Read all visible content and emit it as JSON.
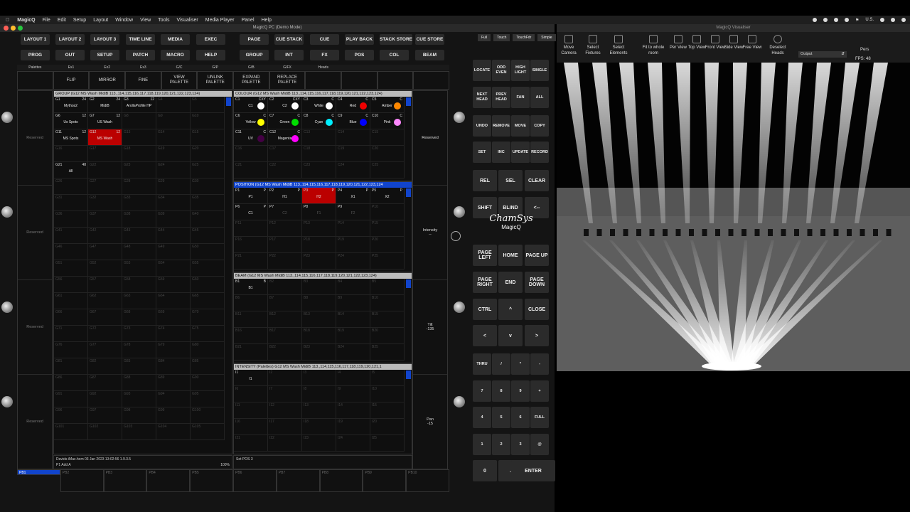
{
  "menubar": {
    "app": "MagicQ",
    "items": [
      "File",
      "Edit",
      "Setup",
      "Layout",
      "Window",
      "View",
      "Tools",
      "Visualiser",
      "Media Player",
      "Panel",
      "Help"
    ],
    "locale": "U.S."
  },
  "window": {
    "title": "MagicQ PC (Demo Mode)"
  },
  "topbuttons": {
    "row1": [
      "LAYOUT 1",
      "LAYOUT 2",
      "LAYOUT 3",
      "TIME LINE",
      "MEDIA",
      "EXEC",
      "PAGE",
      "CUE STACK",
      "CUE",
      "PLAY BACK",
      "STACK STORE",
      "CUE STORE"
    ],
    "row2": [
      "PROG",
      "OUT",
      "SETUP",
      "PATCH",
      "MACRO",
      "HELP",
      "GROUP",
      "INT",
      "FX",
      "POS",
      "COL",
      "BEAM"
    ]
  },
  "modes": [
    "Full",
    "Touch",
    "TouchFdr",
    "Simple"
  ],
  "softrow": [
    "Palettes",
    "Ex1",
    "Ex2",
    "Ex3",
    "G/C",
    "G/P",
    "G/B",
    "G/FX",
    "Heads",
    "",
    "",
    ""
  ],
  "softbuttons": [
    "",
    "FLIP",
    "MIRROR",
    "FINE",
    "VIEW\nPALETTE",
    "UNLINK\nPALETTE",
    "EXPAND\nPALETTE",
    "REPLACE\nPALETTE",
    "",
    "",
    "",
    ""
  ],
  "leftside": [
    "Reserved",
    "Reserved",
    "Reserved",
    "Reserved"
  ],
  "rightside": [
    {
      "t": "Reserved",
      "v": ""
    },
    {
      "t": "Intensity",
      "v": "--"
    },
    {
      "t": "Tilt",
      "v": "-135"
    },
    {
      "t": "Pan",
      "v": "-15"
    }
  ],
  "group": {
    "title": "GROUP (G12 MS Wash MidiB 113.,114,115,116,117,118,119,120,121,122,123,124)",
    "cells": [
      {
        "id": "G1",
        "c": "24",
        "n": "Mythos2"
      },
      {
        "id": "G2",
        "c": "24",
        "n": "MidiB"
      },
      {
        "id": "G3",
        "c": "12",
        "n": "ArollaProfile HP"
      },
      {
        "id": "G4"
      },
      {
        "id": "G5"
      },
      {
        "id": "G6",
        "c": "12",
        "n": "Us Spots"
      },
      {
        "id": "G7",
        "c": "12",
        "n": "US Wash"
      },
      {
        "id": "G8"
      },
      {
        "id": "G9"
      },
      {
        "id": "G10"
      },
      {
        "id": "G11",
        "c": "12",
        "n": "MS Spots"
      },
      {
        "id": "G12",
        "c": "12",
        "n": "MS Wash",
        "red": true
      },
      {
        "id": "G13"
      },
      {
        "id": "G14"
      },
      {
        "id": "G15"
      },
      {
        "id": "G16"
      },
      {
        "id": "G17"
      },
      {
        "id": "G18"
      },
      {
        "id": "G19"
      },
      {
        "id": "G20"
      },
      {
        "id": "G21",
        "c": "48",
        "n": "All"
      },
      {
        "id": "G22"
      },
      {
        "id": "G23"
      },
      {
        "id": "G24"
      },
      {
        "id": "G25"
      },
      {
        "id": "G26"
      },
      {
        "id": "G27"
      },
      {
        "id": "G28"
      },
      {
        "id": "G29"
      },
      {
        "id": "G30"
      },
      {
        "id": "G31"
      },
      {
        "id": "G32"
      },
      {
        "id": "G33"
      },
      {
        "id": "G34"
      },
      {
        "id": "G35"
      },
      {
        "id": "G36"
      },
      {
        "id": "G37"
      },
      {
        "id": "G38"
      },
      {
        "id": "G39"
      },
      {
        "id": "G40"
      },
      {
        "id": "G41"
      },
      {
        "id": "G42"
      },
      {
        "id": "G43"
      },
      {
        "id": "G44"
      },
      {
        "id": "G45"
      },
      {
        "id": "G46"
      },
      {
        "id": "G47"
      },
      {
        "id": "G48"
      },
      {
        "id": "G49"
      },
      {
        "id": "G50"
      },
      {
        "id": "G51"
      },
      {
        "id": "G52"
      },
      {
        "id": "G53"
      },
      {
        "id": "G54"
      },
      {
        "id": "G55"
      },
      {
        "id": "G56"
      },
      {
        "id": "G57"
      },
      {
        "id": "G58"
      },
      {
        "id": "G59"
      },
      {
        "id": "G60"
      },
      {
        "id": "G61"
      },
      {
        "id": "G62"
      },
      {
        "id": "G63"
      },
      {
        "id": "G64"
      },
      {
        "id": "G65"
      },
      {
        "id": "G66"
      },
      {
        "id": "G67"
      },
      {
        "id": "G68"
      },
      {
        "id": "G69"
      },
      {
        "id": "G70"
      },
      {
        "id": "G71"
      },
      {
        "id": "G72"
      },
      {
        "id": "G73"
      },
      {
        "id": "G74"
      },
      {
        "id": "G75"
      },
      {
        "id": "G76"
      },
      {
        "id": "G77"
      },
      {
        "id": "G78"
      },
      {
        "id": "G79"
      },
      {
        "id": "G80"
      },
      {
        "id": "G81"
      },
      {
        "id": "G82"
      },
      {
        "id": "G83"
      },
      {
        "id": "G84"
      },
      {
        "id": "G85"
      },
      {
        "id": "G86"
      },
      {
        "id": "G87"
      },
      {
        "id": "G88"
      },
      {
        "id": "G89"
      },
      {
        "id": "G90"
      },
      {
        "id": "G91"
      },
      {
        "id": "G92"
      },
      {
        "id": "G93"
      },
      {
        "id": "G94"
      },
      {
        "id": "G95"
      },
      {
        "id": "G96"
      },
      {
        "id": "G97"
      },
      {
        "id": "G98"
      },
      {
        "id": "G99"
      },
      {
        "id": "G100"
      },
      {
        "id": "G101"
      },
      {
        "id": "G102"
      },
      {
        "id": "G103"
      },
      {
        "id": "G104"
      },
      {
        "id": "G105"
      }
    ]
  },
  "colour": {
    "title": "COLOUR (G12 MS Wash MidiB 113.,114,115,116,117,118,119,120,121,122,123,124)",
    "cells": [
      {
        "id": "C1",
        "c": "CXY",
        "n": "C1",
        "col": "#ffffff"
      },
      {
        "id": "C2",
        "c": "CXY",
        "n": "C2",
        "col": "#ffffff"
      },
      {
        "id": "C3",
        "c": "C",
        "n": "White",
        "col": "#ffffff"
      },
      {
        "id": "C4",
        "c": "C",
        "n": "Red",
        "col": "#ee0000"
      },
      {
        "id": "C5",
        "c": "C",
        "n": "Amber",
        "col": "#ff8800"
      },
      {
        "id": "C6",
        "c": "C",
        "n": "Yellow",
        "col": "#ffff00"
      },
      {
        "id": "C7",
        "c": "C",
        "n": "Green",
        "col": "#00dd00"
      },
      {
        "id": "C8",
        "c": "C",
        "n": "Cyan",
        "col": "#00eeff"
      },
      {
        "id": "C9",
        "c": "C",
        "n": "Blue",
        "col": "#0000ff"
      },
      {
        "id": "C10",
        "c": "C",
        "n": "Pink",
        "col": "#ff88ff"
      },
      {
        "id": "C11",
        "c": "C",
        "n": "UV",
        "col": "#440044"
      },
      {
        "id": "C12",
        "c": "C",
        "n": "Magenta",
        "col": "#ff00ff"
      },
      {
        "id": "C13"
      },
      {
        "id": "C14"
      },
      {
        "id": "C15"
      },
      {
        "id": "C16"
      },
      {
        "id": "C17"
      },
      {
        "id": "C18"
      },
      {
        "id": "C19"
      },
      {
        "id": "C20"
      },
      {
        "id": "C21"
      },
      {
        "id": "C22"
      },
      {
        "id": "C23"
      },
      {
        "id": "C24"
      },
      {
        "id": "C25"
      }
    ]
  },
  "position": {
    "title": "POSITION (G12 MS Wash MidiB 113.,114,115,116,117,118,119,120,121,122,123,124",
    "cells": [
      {
        "id": "P1",
        "c": "P",
        "n": "P1"
      },
      {
        "id": "P2",
        "c": "P",
        "n": "H1"
      },
      {
        "id": "P3",
        "c": "P",
        "n": "H2",
        "red": true
      },
      {
        "id": "P4",
        "c": "P",
        "n": "X1"
      },
      {
        "id": "P5",
        "c": "P",
        "n": "X2"
      },
      {
        "id": "P6",
        "c": "P",
        "n": "C1"
      },
      {
        "id": "P7",
        "n": "C2",
        "dim": true
      },
      {
        "id": "P8",
        "n": "F1",
        "dim": true
      },
      {
        "id": "P9",
        "n": "F2",
        "dim": true
      },
      {
        "id": "P10"
      },
      {
        "id": "P11"
      },
      {
        "id": "P12"
      },
      {
        "id": "P13"
      },
      {
        "id": "P14"
      },
      {
        "id": "P15"
      },
      {
        "id": "P16"
      },
      {
        "id": "P17"
      },
      {
        "id": "P18"
      },
      {
        "id": "P19"
      },
      {
        "id": "P20"
      },
      {
        "id": "P21"
      },
      {
        "id": "P22"
      },
      {
        "id": "P23"
      },
      {
        "id": "P24"
      },
      {
        "id": "P25"
      }
    ]
  },
  "beam": {
    "title": "BEAM (G12 MS Wash MidiB 113.,114,115,116,117,118,119,120,121,122,123,124)",
    "cells": [
      {
        "id": "B1",
        "c": "B",
        "n": "B1"
      },
      {
        "id": "B2"
      },
      {
        "id": "B3"
      },
      {
        "id": "B4"
      },
      {
        "id": "B5"
      },
      {
        "id": "B6"
      },
      {
        "id": "B7"
      },
      {
        "id": "B8"
      },
      {
        "id": "B9"
      },
      {
        "id": "B10"
      },
      {
        "id": "B11"
      },
      {
        "id": "B12"
      },
      {
        "id": "B13"
      },
      {
        "id": "B14"
      },
      {
        "id": "B15"
      },
      {
        "id": "B16"
      },
      {
        "id": "B17"
      },
      {
        "id": "B18"
      },
      {
        "id": "B19"
      },
      {
        "id": "B20"
      },
      {
        "id": "B21"
      },
      {
        "id": "B22"
      },
      {
        "id": "B23"
      },
      {
        "id": "B24"
      },
      {
        "id": "B25"
      }
    ]
  },
  "intensity": {
    "title": "INTENSITY (Palettes) G12 MS Wash MidiB 113.,114,115,116,117,118,119,120,121,1",
    "cells": [
      {
        "id": "I1",
        "n": "I1"
      },
      {
        "id": "I2"
      },
      {
        "id": "I3"
      },
      {
        "id": "I4"
      },
      {
        "id": "I5"
      },
      {
        "id": "I6"
      },
      {
        "id": "I7"
      },
      {
        "id": "I8"
      },
      {
        "id": "I9"
      },
      {
        "id": "I10"
      },
      {
        "id": "I11"
      },
      {
        "id": "I12"
      },
      {
        "id": "I13"
      },
      {
        "id": "I14"
      },
      {
        "id": "I15"
      },
      {
        "id": "I16"
      },
      {
        "id": "I17"
      },
      {
        "id": "I18"
      },
      {
        "id": "I19"
      },
      {
        "id": "I20"
      },
      {
        "id": "I21"
      },
      {
        "id": "I22"
      },
      {
        "id": "I23"
      },
      {
        "id": "I24"
      },
      {
        "id": "I25"
      }
    ]
  },
  "status": {
    "line1": "Davids-iMac.hom 03 Jan 2023 13:02:56 1.9.3.5",
    "line2": "P1 Add A",
    "zoom": "100%",
    "cmd": "Set POS 3"
  },
  "playbacks": [
    "PB1",
    "PB2",
    "PB3",
    "PB4",
    "PB5",
    "PB6",
    "PB7",
    "PB8",
    "PB9",
    "PB10"
  ],
  "keys": {
    "r1": [
      "LOCATE",
      "ODD EVEN",
      "HIGH LIGHT",
      "SINGLE"
    ],
    "r2": [
      "NEXT HEAD",
      "PREV HEAD",
      "FAN",
      "ALL"
    ],
    "r3": [
      "UNDO",
      "REMOVE",
      "MOVE",
      "COPY"
    ],
    "r4": [
      "SET",
      "INC",
      "UPDATE",
      "RECORD"
    ],
    "r5": [
      "REL",
      "SEL",
      "CLEAR"
    ],
    "r6": [
      "SHIFT",
      "BLIND",
      "<--"
    ],
    "r7": [
      "PAGE LEFT",
      "HOME",
      "PAGE UP"
    ],
    "r8": [
      "PAGE RIGHT",
      "END",
      "PAGE DOWN"
    ],
    "r9": [
      "CTRL",
      "^",
      "CLOSE"
    ],
    "r10": [
      "<",
      "v",
      ">"
    ],
    "n1": [
      "THRU",
      "/",
      "*",
      "-"
    ],
    "n2": [
      "7",
      "8",
      "9",
      "+"
    ],
    "n3": [
      "4",
      "5",
      "6",
      "FULL"
    ],
    "n4": [
      "1",
      "2",
      "3",
      "@"
    ],
    "n5": [
      "0",
      ".",
      "ENTER"
    ]
  },
  "logo": {
    "l1": "ChamSys",
    "l2": "MagicQ"
  },
  "visualiser": {
    "title": "MagicQ Visualiser",
    "tools": [
      "Move Camera",
      "Select Fixtures",
      "Select Elements",
      "Fit to whole room",
      "Per View",
      "Top View",
      "Front View",
      "Side View",
      "Free View",
      "Deselect Heads"
    ],
    "view": "Output",
    "pers": "Pers",
    "fps": "FPS: 48"
  }
}
